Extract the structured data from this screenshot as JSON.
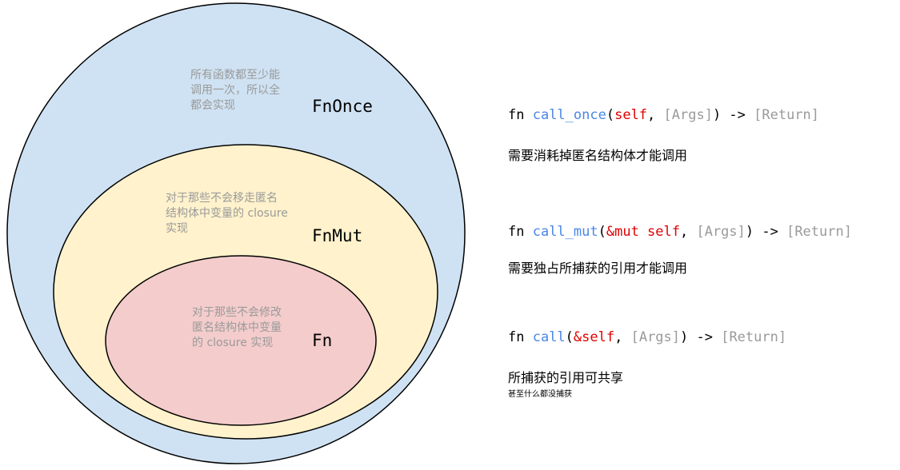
{
  "colors": {
    "outer_fill": "#cfe2f3",
    "middle_fill": "#fff2cc",
    "inner_fill": "#f4cccc",
    "stroke": "#000000",
    "fn_name": "#4a86e8",
    "keyword": "#e00000",
    "muted": "#9a9a9a"
  },
  "sets": {
    "fn_once": {
      "title": "FnOnce",
      "note": "所有函数都至少能\n调用一次，所以全\n都会实现"
    },
    "fn_mut": {
      "title": "FnMut",
      "note": "对于那些不会移走匿名\n结构体中变量的 closure\n实现"
    },
    "fn": {
      "title": "Fn",
      "note": "对于那些不会修改\n匿名结构体中变量\n的 closure 实现"
    }
  },
  "signatures": {
    "call_once": {
      "prefix": "fn ",
      "name": "call_once",
      "open": "(",
      "receiver": "self",
      "sep": ", ",
      "args": "[Args]",
      "mid": ") -> ",
      "ret": "[Return]",
      "desc": "需要消耗掉匿名结构体才能调用"
    },
    "call_mut": {
      "prefix": "fn ",
      "name": "call_mut",
      "open": "(",
      "receiver": "&mut self",
      "sep": ", ",
      "args": "[Args]",
      "mid": ") -> ",
      "ret": "[Return]",
      "desc": "需要独占所捕获的引用才能调用"
    },
    "call": {
      "prefix": "fn ",
      "name": "call",
      "open": "(",
      "receiver": "&self",
      "sep": ", ",
      "args": "[Args]",
      "mid": ") -> ",
      "ret": "[Return]",
      "desc": "所捕获的引用可共享",
      "subdesc": "甚至什么都没捕获"
    }
  }
}
